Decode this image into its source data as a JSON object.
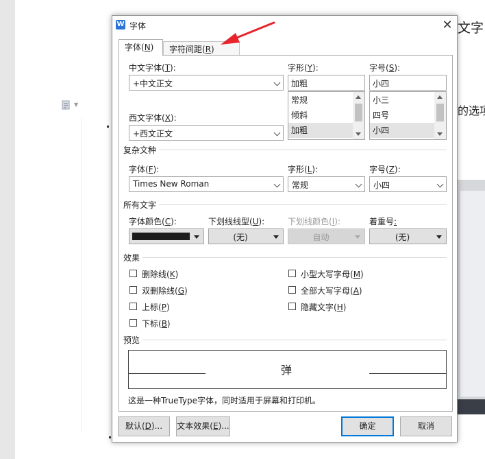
{
  "background_doc": {
    "text_top": "文字，",
    "text_mid": "的选项"
  },
  "dialog": {
    "title": "字体",
    "app_icon": "W",
    "close_glyph": "✕",
    "tabs": [
      {
        "prefix": "字体(",
        "key": "N",
        "suffix": ")"
      },
      {
        "prefix": "字符间距(",
        "key": "R",
        "suffix": ")"
      }
    ],
    "cn_font": {
      "label_prefix": "中文字体(",
      "key": "T",
      "label_suffix": "):",
      "value": "+中文正文"
    },
    "west_font": {
      "label_prefix": "西文字体(",
      "key": "X",
      "label_suffix": "):",
      "value": "+西文正文"
    },
    "style": {
      "label_prefix": "字形(",
      "key": "Y",
      "label_suffix": "):",
      "value": "加粗",
      "options": [
        "常规",
        "倾斜",
        "加粗"
      ],
      "selected": "加粗"
    },
    "size": {
      "label_prefix": "字号(",
      "key": "S",
      "label_suffix": "):",
      "value": "小四",
      "options": [
        "小三",
        "四号",
        "小四"
      ],
      "selected": "小四"
    },
    "complex": {
      "title": "复杂文种",
      "font_label_prefix": "字体(",
      "font_key": "F",
      "font_label_suffix": "):",
      "font_value": "Times New Roman",
      "style_label_prefix": "字形(",
      "style_key": "L",
      "style_label_suffix": "):",
      "style_value": "常规",
      "size_label_prefix": "字号(",
      "size_key": "Z",
      "size_label_suffix": "):",
      "size_value": "小四"
    },
    "all_text": {
      "title": "所有文字",
      "color_label_prefix": "字体颜色(",
      "color_key": "C",
      "color_label_suffix": "):",
      "color_value": "#1c1c1c",
      "underline_label_prefix": "下划线线型(",
      "underline_key": "U",
      "underline_label_suffix": "):",
      "underline_value": "(无)",
      "underline_color_label_prefix": "下划线颜色(",
      "underline_color_key": "I",
      "underline_color_label_suffix": "):",
      "underline_color_value": "自动",
      "emphasis_label_prefix": "着重号",
      "emphasis_key": ":",
      "emphasis_value": "(无)"
    },
    "effects": {
      "title": "效果",
      "items": [
        {
          "prefix": "删除线(",
          "key": "K",
          "suffix": ")",
          "checked": false
        },
        {
          "prefix": "双删除线(",
          "key": "G",
          "suffix": ")",
          "checked": false
        },
        {
          "prefix": "上标(",
          "key": "P",
          "suffix": ")",
          "checked": false
        },
        {
          "prefix": "下标(",
          "key": "B",
          "suffix": ")",
          "checked": false
        },
        {
          "prefix": "小型大写字母(",
          "key": "M",
          "suffix": ")",
          "checked": false
        },
        {
          "prefix": "全部大写字母(",
          "key": "A",
          "suffix": ")",
          "checked": false
        },
        {
          "prefix": "隐藏文字(",
          "key": "H",
          "suffix": ")",
          "checked": false
        }
      ]
    },
    "preview": {
      "title": "预览",
      "sample": "弹"
    },
    "note": "这是一种TrueType字体，同时适用于屏幕和打印机。",
    "buttons": {
      "default": {
        "prefix": "默认(",
        "key": "D",
        "suffix": ")..."
      },
      "text_effects": {
        "prefix": "文本效果(",
        "key": "E",
        "suffix": ")..."
      },
      "ok": "确定",
      "cancel": "取消"
    },
    "annotation_arrow_color": "#e8242c"
  }
}
